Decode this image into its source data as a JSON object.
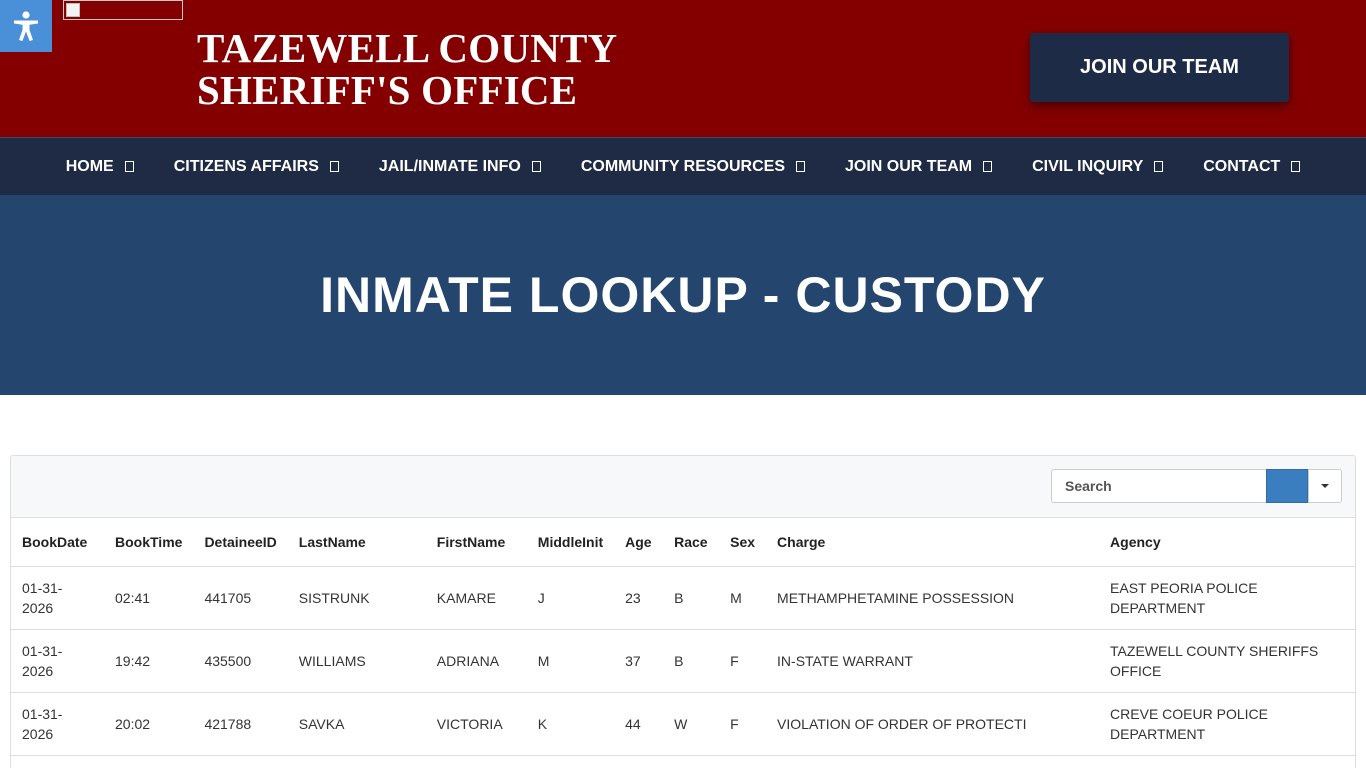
{
  "header": {
    "title_line1": "TAZEWELL COUNTY",
    "title_line2": "SHERIFF'S OFFICE",
    "join_button": "JOIN OUR TEAM",
    "accessibility_icon": "accessibility-person-icon"
  },
  "nav": {
    "items": [
      {
        "label": "HOME"
      },
      {
        "label": "CITIZENS AFFAIRS"
      },
      {
        "label": "JAIL/INMATE INFO"
      },
      {
        "label": "COMMUNITY RESOURCES"
      },
      {
        "label": "JOIN OUR TEAM"
      },
      {
        "label": "CIVIL INQUIRY"
      },
      {
        "label": "CONTACT"
      }
    ]
  },
  "banner": {
    "title": "INMATE LOOKUP - CUSTODY"
  },
  "search": {
    "placeholder": "Search"
  },
  "table": {
    "columns": [
      "BookDate",
      "BookTime",
      "DetaineeID",
      "LastName",
      "FirstName",
      "MiddleInit",
      "Age",
      "Race",
      "Sex",
      "Charge",
      "Agency"
    ],
    "rows": [
      {
        "book_date": "01-31-2026",
        "book_time": "02:41",
        "detainee_id": "441705",
        "last_name": "SISTRUNK",
        "first_name": "KAMARE",
        "middle_init": "J",
        "age": "23",
        "race": "B",
        "sex": "M",
        "charge": "METHAMPHETAMINE POSSESSION",
        "agency": "EAST PEORIA POLICE DEPARTMENT"
      },
      {
        "book_date": "01-31-2026",
        "book_time": "19:42",
        "detainee_id": "435500",
        "last_name": "WILLIAMS",
        "first_name": "ADRIANA",
        "middle_init": "M",
        "age": "37",
        "race": "B",
        "sex": "F",
        "charge": "IN-STATE WARRANT",
        "agency": "TAZEWELL COUNTY SHERIFFS OFFICE"
      },
      {
        "book_date": "01-31-2026",
        "book_time": "20:02",
        "detainee_id": "421788",
        "last_name": "SAVKA",
        "first_name": "VICTORIA",
        "middle_init": "K",
        "age": "44",
        "race": "W",
        "sex": "F",
        "charge": "VIOLATION OF ORDER OF PROTECTI",
        "agency": "CREVE COEUR POLICE DEPARTMENT"
      }
    ]
  },
  "colors": {
    "header_red": "#840000",
    "nav_navy": "#1f2b45",
    "banner_blue": "#24466e",
    "join_button": "#1e2b47",
    "accessibility_blue": "#4a90d9",
    "search_button": "#3a7ebf"
  }
}
